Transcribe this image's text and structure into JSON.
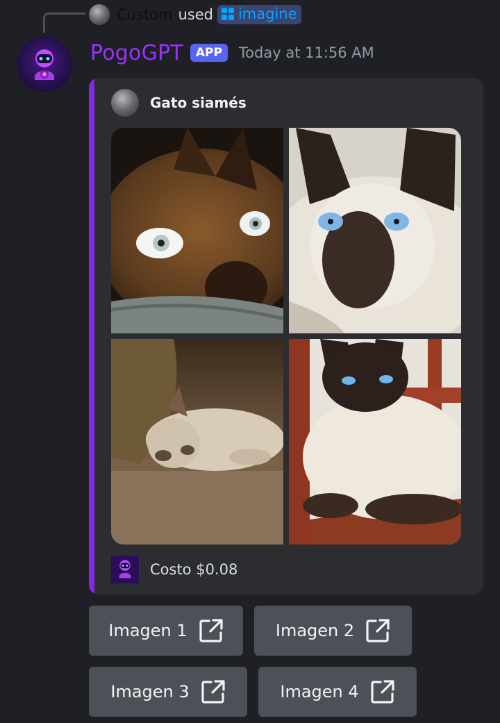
{
  "reply": {
    "user": "Custom",
    "used_text": "used",
    "command": "imagine"
  },
  "message": {
    "bot_name": "PogoGPT",
    "badge": "APP",
    "timestamp": "Today at 11:56 AM"
  },
  "embed": {
    "accent_color": "#8527e6",
    "author": "Gato siamés",
    "footer": "Costo $0.08",
    "images": [
      {
        "subject": "brown cat with glowing eyes"
      },
      {
        "subject": "siamese cat with blue eyes"
      },
      {
        "subject": "cream cat lying under cushion"
      },
      {
        "subject": "siamese cat lying on chair"
      }
    ]
  },
  "buttons": [
    {
      "label": "Imagen 1",
      "icon": "external-link-icon"
    },
    {
      "label": "Imagen 2",
      "icon": "external-link-icon"
    },
    {
      "label": "Imagen 3",
      "icon": "external-link-icon"
    },
    {
      "label": "Imagen 4",
      "icon": "external-link-icon"
    }
  ]
}
